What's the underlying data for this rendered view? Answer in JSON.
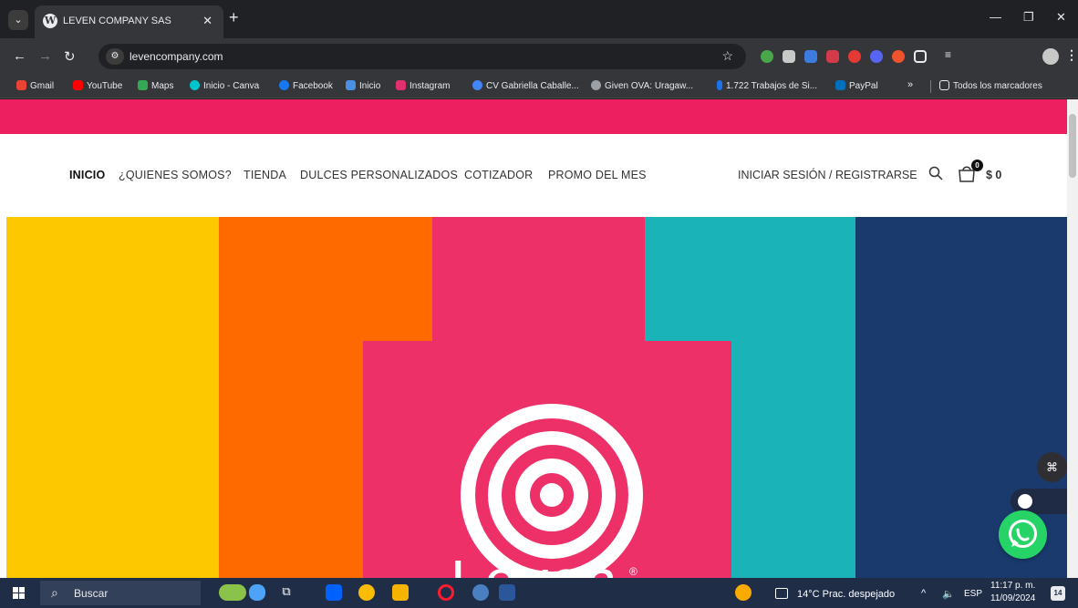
{
  "browser": {
    "tab": {
      "title": "LEVEN COMPANY SAS",
      "favicon": "wordpress-icon"
    },
    "url": "levencompany.com",
    "bookmarks": [
      {
        "label": "Gmail",
        "color": "#ea4335"
      },
      {
        "label": "YouTube",
        "color": "#ff0000"
      },
      {
        "label": "Maps",
        "color": "#34a853"
      },
      {
        "label": "Inicio - Canva",
        "color": "#00c4cc"
      },
      {
        "label": "Facebook",
        "color": "#1877f2"
      },
      {
        "label": "Inicio",
        "color": "#4a90e2"
      },
      {
        "label": "Instagram",
        "color": "#e1306c"
      },
      {
        "label": "CV Gabriella Caballe...",
        "color": "#4285f4"
      },
      {
        "label": "Given OVA: Uragaw...",
        "color": "#9aa0a6"
      },
      {
        "label": "1.722 Trabajos de Si...",
        "color": "#1a73e8"
      },
      {
        "label": "PayPal",
        "color": "#0070ba"
      }
    ],
    "all_bookmarks": "Todos los marcadores"
  },
  "site": {
    "brand_color": "#ee1f60",
    "menu": [
      "INICIO",
      "¿QUIENES SOMOS?",
      "TIENDA",
      "DULCES PERSONALIZADOS",
      "COTIZADOR",
      "PROMO DEL MES"
    ],
    "login": "INICIAR SESIÓN / REGISTRARSE",
    "cart_count": "0",
    "cart_total": "$ 0",
    "hero": {
      "word": "Leven",
      "registered": "®",
      "colors": [
        "#fec800",
        "#ff6a00",
        "#ee3068",
        "#1ab3b8",
        "#1a3a6e"
      ]
    }
  },
  "taskbar": {
    "search_placeholder": "Buscar",
    "weather": "14°C  Prac. despejado",
    "language": "ESP",
    "time": "11:17 p. m.",
    "date": "11/09/2024",
    "notifications": "14"
  }
}
